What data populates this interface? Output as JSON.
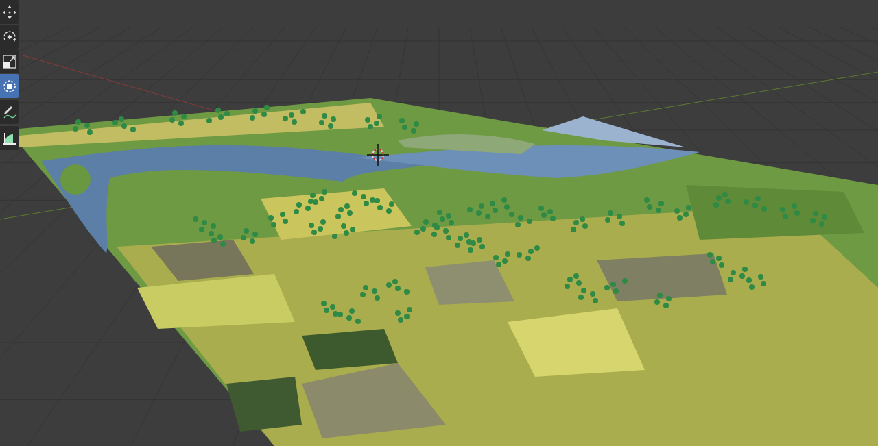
{
  "toolbar": {
    "tools": [
      {
        "kind": "move",
        "selected": false
      },
      {
        "kind": "rotate",
        "selected": false
      },
      {
        "kind": "scale",
        "selected": false
      },
      {
        "kind": "transform",
        "selected": true
      },
      {
        "kind": "annotate",
        "selected": false
      },
      {
        "kind": "measure",
        "selected": false
      }
    ]
  }
}
